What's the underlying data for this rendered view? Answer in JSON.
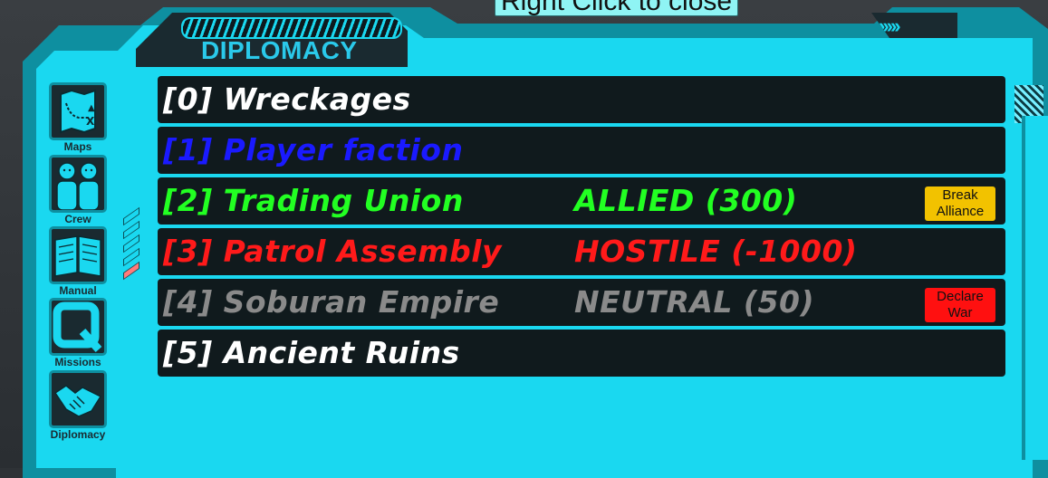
{
  "tooltip": "Right Click to close",
  "window": {
    "title": "DIPLOMACY",
    "chevrons": "›››››"
  },
  "sidebar": {
    "items": [
      {
        "label": "Maps",
        "icon": "map-icon"
      },
      {
        "label": "Crew",
        "icon": "crew-icon"
      },
      {
        "label": "Manual",
        "icon": "book-icon"
      },
      {
        "label": "Missions",
        "icon": "missions-q-icon"
      },
      {
        "label": "Diplomacy",
        "icon": "handshake-icon"
      }
    ]
  },
  "factions": [
    {
      "name": "[0] Wreckages",
      "status": "",
      "action": "",
      "color": "#ffffff"
    },
    {
      "name": "[1] Player faction",
      "status": "",
      "action": "",
      "color": "#1a1aff"
    },
    {
      "name": "[2] Trading Union",
      "status": "ALLIED (300)",
      "action": "Break\nAlliance",
      "color": "#22ff22",
      "action_color": "#f2c200"
    },
    {
      "name": "[3] Patrol Assembly",
      "status": "HOSTILE (-1000)",
      "action": "",
      "color": "#ff1a1a"
    },
    {
      "name": "[4] Soburan Empire",
      "status": "NEUTRAL (50)",
      "action": "Declare\nWar",
      "color": "#8a8a8a",
      "action_color": "#ff1010"
    },
    {
      "name": "[5] Ancient Ruins",
      "status": "",
      "action": "",
      "color": "#ffffff"
    }
  ]
}
